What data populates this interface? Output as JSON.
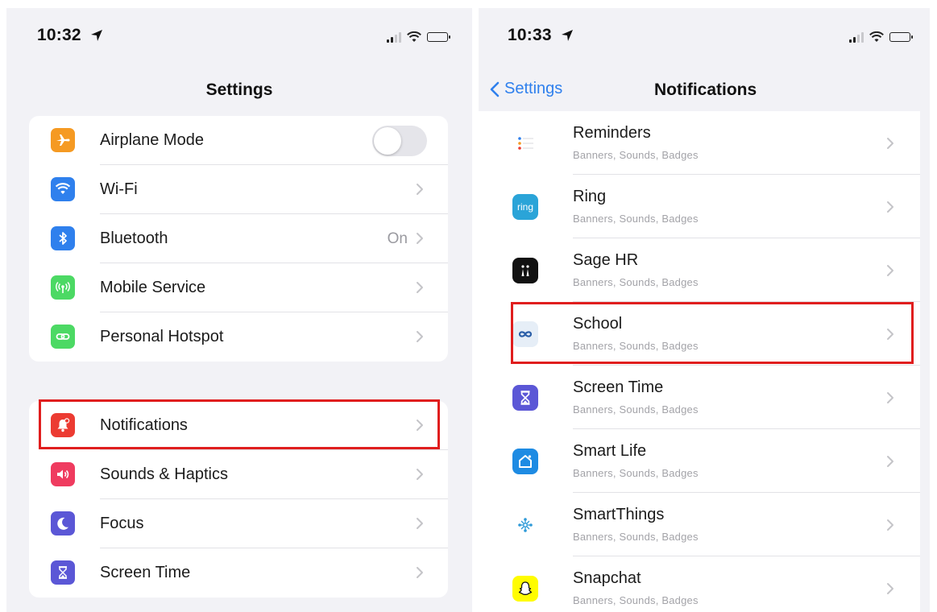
{
  "colors": {
    "background": "#f2f2f6",
    "card": "#ffffff",
    "accent_blue": "#2f80ed",
    "highlight_red": "#e01e1e",
    "secondary_text": "#a3a3a8"
  },
  "left": {
    "status": {
      "time": "10:32",
      "location_icon": "location-arrow-icon",
      "icons": [
        "cellular-signal-icon",
        "wifi-icon",
        "battery-icon"
      ]
    },
    "title": "Settings",
    "group1": [
      {
        "label": "Airplane Mode",
        "icon": "airplane-icon",
        "color": "#f59a23",
        "control": "toggle",
        "toggle_on": false
      },
      {
        "label": "Wi-Fi",
        "icon": "wifi-icon",
        "color": "#2f80ed",
        "control": "chevron"
      },
      {
        "label": "Bluetooth",
        "icon": "bluetooth-icon",
        "color": "#2f80ed",
        "control": "chevron",
        "value": "On"
      },
      {
        "label": "Mobile Service",
        "icon": "antenna-icon",
        "color": "#4cd964",
        "control": "chevron"
      },
      {
        "label": "Personal Hotspot",
        "icon": "hotspot-link-icon",
        "color": "#4cd964",
        "control": "chevron"
      }
    ],
    "group2": [
      {
        "label": "Notifications",
        "icon": "bell-icon",
        "color": "#ec3b32",
        "control": "chevron",
        "highlighted": true
      },
      {
        "label": "Sounds & Haptics",
        "icon": "speaker-icon",
        "color": "#ef3b5f",
        "control": "chevron"
      },
      {
        "label": "Focus",
        "icon": "moon-icon",
        "color": "#5b57d6",
        "control": "chevron"
      },
      {
        "label": "Screen Time",
        "icon": "hourglass-icon",
        "color": "#5b57d6",
        "control": "chevron"
      }
    ]
  },
  "right": {
    "status": {
      "time": "10:33",
      "location_icon": "location-arrow-icon",
      "icons": [
        "cellular-signal-icon",
        "wifi-icon",
        "battery-icon"
      ]
    },
    "back_label": "Settings",
    "title": "Notifications",
    "apps": [
      {
        "name": "Reminders",
        "detail": "Banners, Sounds, Badges",
        "icon": "reminders-list-icon"
      },
      {
        "name": "Ring",
        "detail": "Banners, Sounds, Badges",
        "icon": "ring-logo-icon",
        "icon_text": "ring"
      },
      {
        "name": "Sage HR",
        "detail": "Banners, Sounds, Badges",
        "icon": "sage-hr-icon"
      },
      {
        "name": "School",
        "detail": "Banners, Sounds, Badges",
        "icon": "infinity-icon",
        "highlighted": true
      },
      {
        "name": "Screen Time",
        "detail": "Banners, Sounds, Badges",
        "icon": "hourglass-icon"
      },
      {
        "name": "Smart Life",
        "detail": "Banners, Sounds, Badges",
        "icon": "smart-home-icon"
      },
      {
        "name": "SmartThings",
        "detail": "Banners, Sounds, Badges",
        "icon": "smartthings-icon"
      },
      {
        "name": "Snapchat",
        "detail": "Banners, Sounds, Badges",
        "icon": "ghost-icon"
      }
    ]
  }
}
